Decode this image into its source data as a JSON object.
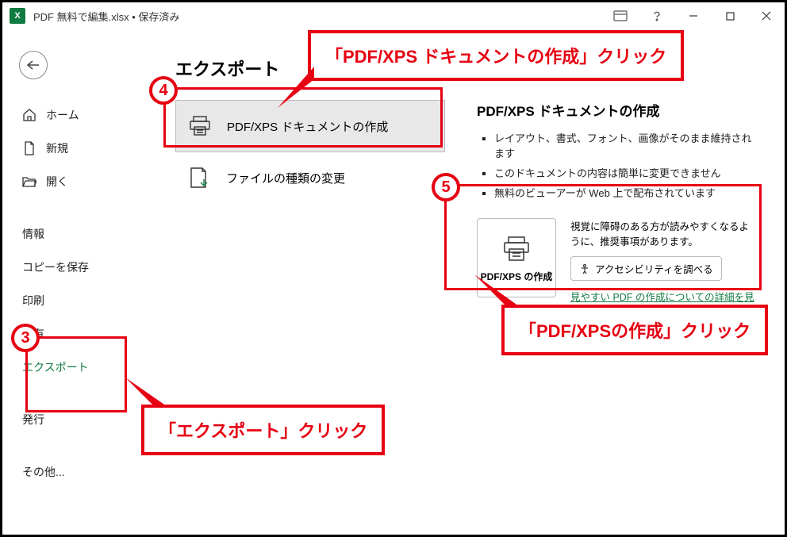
{
  "titlebar": {
    "filename": "PDF 無料で編集.xlsx • 保存済み"
  },
  "sidebar": {
    "home": "ホーム",
    "new": "新規",
    "open": "開く",
    "info": "情報",
    "save_copy": "コピーを保存",
    "print": "印刷",
    "share": "共有",
    "export": "エクスポート",
    "publish": "発行",
    "more": "その他..."
  },
  "main": {
    "title": "エクスポート",
    "opt_pdfxps": "PDF/XPS ドキュメントの作成",
    "opt_filetype": "ファイルの種類の変更"
  },
  "panel": {
    "title": "PDF/XPS ドキュメントの作成",
    "bullet1": "レイアウト、書式、フォント、画像がそのまま維持されます",
    "bullet2": "このドキュメントの内容は簡単に変更できません",
    "bullet3": "無料のビューアーが Web 上で配布されています",
    "create_label": "PDF/XPS の作成",
    "info_text": "視覚に障碍のある方が読みやすくなるように、推奨事項があります。",
    "acc_button": "アクセシビリティを調べる",
    "link": "見やすい PDF の作成についての詳細を見る"
  },
  "annotations": {
    "n3": "3",
    "n4": "4",
    "n5": "5",
    "label_export": "「エクスポート」クリック",
    "label_pdfxps_doc": "「PDF/XPS ドキュメントの作成」クリック",
    "label_pdfxps_create": "「PDF/XPSの作成」クリック"
  }
}
